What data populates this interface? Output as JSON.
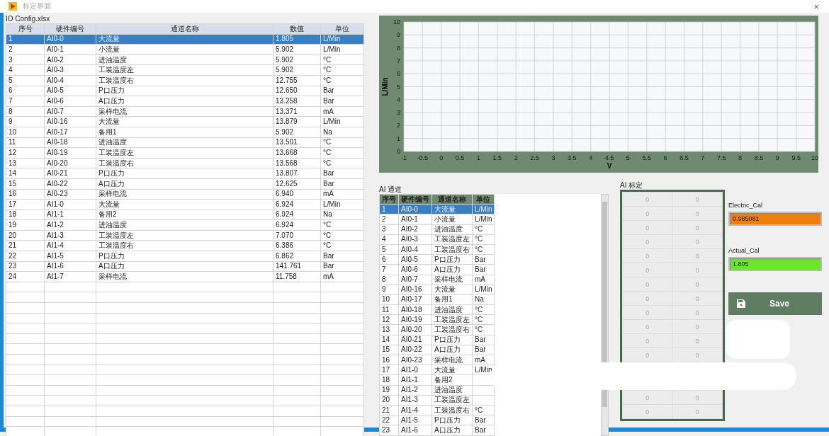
{
  "window": {
    "title": "标定界面",
    "close": "×"
  },
  "io_table": {
    "caption": "IO Config.xlsx",
    "columns": [
      "序号",
      "硬件编号",
      "通道名称",
      "数值",
      "单位"
    ],
    "rows": [
      {
        "cells": [
          "1",
          "AI0-0",
          "大流量",
          "1.805",
          "L/Min"
        ],
        "selected": true
      },
      {
        "cells": [
          "2",
          "AI0-1",
          "小流量",
          "5.902",
          "L/Min"
        ],
        "selected": false
      },
      {
        "cells": [
          "3",
          "AI0-2",
          "进油温度",
          "5.902",
          "°C"
        ],
        "selected": false
      },
      {
        "cells": [
          "4",
          "AI0-3",
          "工装温度左",
          "5.902",
          "°C"
        ],
        "selected": false
      },
      {
        "cells": [
          "5",
          "AI0-4",
          "工装温度右",
          "12.755",
          "°C"
        ],
        "selected": false
      },
      {
        "cells": [
          "6",
          "AI0-5",
          "P口压力",
          "12.650",
          "Bar"
        ],
        "selected": false
      },
      {
        "cells": [
          "7",
          "AI0-6",
          "A口压力",
          "13.258",
          "Bar"
        ],
        "selected": false
      },
      {
        "cells": [
          "8",
          "AI0-7",
          "采样电流",
          "13.371",
          "mA"
        ],
        "selected": false
      },
      {
        "cells": [
          "9",
          "AI0-16",
          "大流量",
          "13.879",
          "L/Min"
        ],
        "selected": false
      },
      {
        "cells": [
          "10",
          "AI0-17",
          "备用1",
          "5.902",
          "Na"
        ],
        "selected": false
      },
      {
        "cells": [
          "11",
          "AI0-18",
          "进油温度",
          "13.501",
          "°C"
        ],
        "selected": false
      },
      {
        "cells": [
          "12",
          "AI0-19",
          "工装温度左",
          "13.668",
          "°C"
        ],
        "selected": false
      },
      {
        "cells": [
          "13",
          "AI0-20",
          "工装温度右",
          "13.568",
          "°C"
        ],
        "selected": false
      },
      {
        "cells": [
          "14",
          "AI0-21",
          "P口压力",
          "13.807",
          "Bar"
        ],
        "selected": false
      },
      {
        "cells": [
          "15",
          "AI0-22",
          "A口压力",
          "12.625",
          "Bar"
        ],
        "selected": false
      },
      {
        "cells": [
          "16",
          "AI0-23",
          "采样电流",
          "6.940",
          "mA"
        ],
        "selected": false
      },
      {
        "cells": [
          "17",
          "AI1-0",
          "大流量",
          "6.924",
          "L/Min"
        ],
        "selected": false
      },
      {
        "cells": [
          "18",
          "AI1-1",
          "备用2",
          "6.924",
          "Na"
        ],
        "selected": false
      },
      {
        "cells": [
          "19",
          "AI1-2",
          "进油温度",
          "6.924",
          "°C"
        ],
        "selected": false
      },
      {
        "cells": [
          "20",
          "AI1-3",
          "工装温度左",
          "7.070",
          "°C"
        ],
        "selected": false
      },
      {
        "cells": [
          "21",
          "AI1-4",
          "工装温度右",
          "6.386",
          "°C"
        ],
        "selected": false
      },
      {
        "cells": [
          "22",
          "AI1-5",
          "P口压力",
          "6.862",
          "Bar"
        ],
        "selected": false
      },
      {
        "cells": [
          "23",
          "AI1-6",
          "A口压力",
          "141.761",
          "Bar"
        ],
        "selected": false
      },
      {
        "cells": [
          "24",
          "AI1-7",
          "采样电流",
          "11.758",
          "mA"
        ],
        "selected": false
      }
    ]
  },
  "chart": {
    "chart_data": {
      "type": "line",
      "xlabel": "V",
      "ylabel": "L/Min",
      "xlim": [
        -1,
        10
      ],
      "ylim": [
        0,
        10
      ],
      "xticks": [
        -1,
        -0.5,
        0,
        0.5,
        1,
        1.5,
        2,
        2.5,
        3,
        3.5,
        4,
        4.5,
        5,
        5.5,
        6,
        6.5,
        7,
        7.5,
        8,
        8.5,
        9,
        9.5,
        10
      ],
      "yticks": [
        0,
        1,
        2,
        3,
        4,
        5,
        6,
        7,
        8,
        9,
        10
      ],
      "grid": true
    }
  },
  "ai_channels": {
    "caption": "AI 通道",
    "columns": [
      "序号",
      "硬件编号",
      "通道名称",
      "单位"
    ],
    "rows": [
      {
        "cells": [
          "1",
          "AI0-0",
          "大流量",
          "L/Min"
        ],
        "selected": true
      },
      {
        "cells": [
          "2",
          "AI0-1",
          "小流量",
          "L/Min"
        ],
        "selected": false
      },
      {
        "cells": [
          "3",
          "AI0-2",
          "进油温度",
          "°C"
        ],
        "selected": false
      },
      {
        "cells": [
          "4",
          "AI0-3",
          "工装温度左",
          "°C"
        ],
        "selected": false
      },
      {
        "cells": [
          "5",
          "AI0-4",
          "工装温度右",
          "°C"
        ],
        "selected": false
      },
      {
        "cells": [
          "6",
          "AI0-5",
          "P口压力",
          "Bar"
        ],
        "selected": false
      },
      {
        "cells": [
          "7",
          "AI0-6",
          "A口压力",
          "Bar"
        ],
        "selected": false
      },
      {
        "cells": [
          "8",
          "AI0-7",
          "采样电流",
          "mA"
        ],
        "selected": false
      },
      {
        "cells": [
          "9",
          "AI0-16",
          "大流量",
          "L/Min"
        ],
        "selected": false
      },
      {
        "cells": [
          "10",
          "AI0-17",
          "备用1",
          "Na"
        ],
        "selected": false
      },
      {
        "cells": [
          "11",
          "AI0-18",
          "进油温度",
          "°C"
        ],
        "selected": false
      },
      {
        "cells": [
          "12",
          "AI0-19",
          "工装温度左",
          "°C"
        ],
        "selected": false
      },
      {
        "cells": [
          "13",
          "AI0-20",
          "工装温度右",
          "°C"
        ],
        "selected": false
      },
      {
        "cells": [
          "14",
          "AI0-21",
          "P口压力",
          "Bar"
        ],
        "selected": false
      },
      {
        "cells": [
          "15",
          "AI0-22",
          "A口压力",
          "Bar"
        ],
        "selected": false
      },
      {
        "cells": [
          "16",
          "AI0-23",
          "采样电流",
          "mA"
        ],
        "selected": false
      },
      {
        "cells": [
          "17",
          "AI1-0",
          "大流量",
          "L/Min"
        ],
        "selected": false
      },
      {
        "cells": [
          "18",
          "AI1-1",
          "备用2"
        ],
        "selected": false
      },
      {
        "cells": [
          "19",
          "AI1-2",
          "进油温度"
        ],
        "selected": false
      },
      {
        "cells": [
          "20",
          "AI1-3",
          "工装温度左"
        ],
        "selected": false
      },
      {
        "cells": [
          "21",
          "AI1-4",
          "工装温度右",
          "°C"
        ],
        "selected": false
      },
      {
        "cells": [
          "22",
          "AI1-5",
          "P口压力",
          "Bar"
        ],
        "selected": false
      },
      {
        "cells": [
          "23",
          "AI1-6",
          "A口压力",
          "Bar"
        ],
        "selected": false
      }
    ]
  },
  "ai_calibration": {
    "caption": "AI 标定",
    "rows": [
      {
        "cells": [
          "0",
          "0"
        ]
      },
      {
        "cells": [
          "0",
          "0"
        ]
      },
      {
        "cells": [
          "0",
          "0"
        ]
      },
      {
        "cells": [
          "0",
          "0"
        ]
      },
      {
        "cells": [
          "0",
          "0"
        ]
      },
      {
        "cells": [
          "0",
          "0"
        ]
      },
      {
        "cells": [
          "0",
          "0"
        ]
      },
      {
        "cells": [
          "0",
          "0"
        ]
      },
      {
        "cells": [
          "0",
          "0"
        ]
      },
      {
        "cells": [
          "0",
          "0"
        ]
      },
      {
        "cells": [
          "0",
          "0"
        ]
      },
      {
        "cells": [
          "0",
          "0"
        ]
      },
      {},
      {},
      {
        "cells": [
          "0",
          "0"
        ]
      },
      {
        "cells": [
          "0",
          "0"
        ]
      }
    ]
  },
  "fields": [
    {
      "label": "Electric_Cal",
      "value": "0.985081",
      "color": "#f07f10"
    },
    {
      "label": "Actual_Cal",
      "value": "1.805",
      "color": "#6ee52a"
    }
  ],
  "save_button": {
    "label": "Save"
  }
}
